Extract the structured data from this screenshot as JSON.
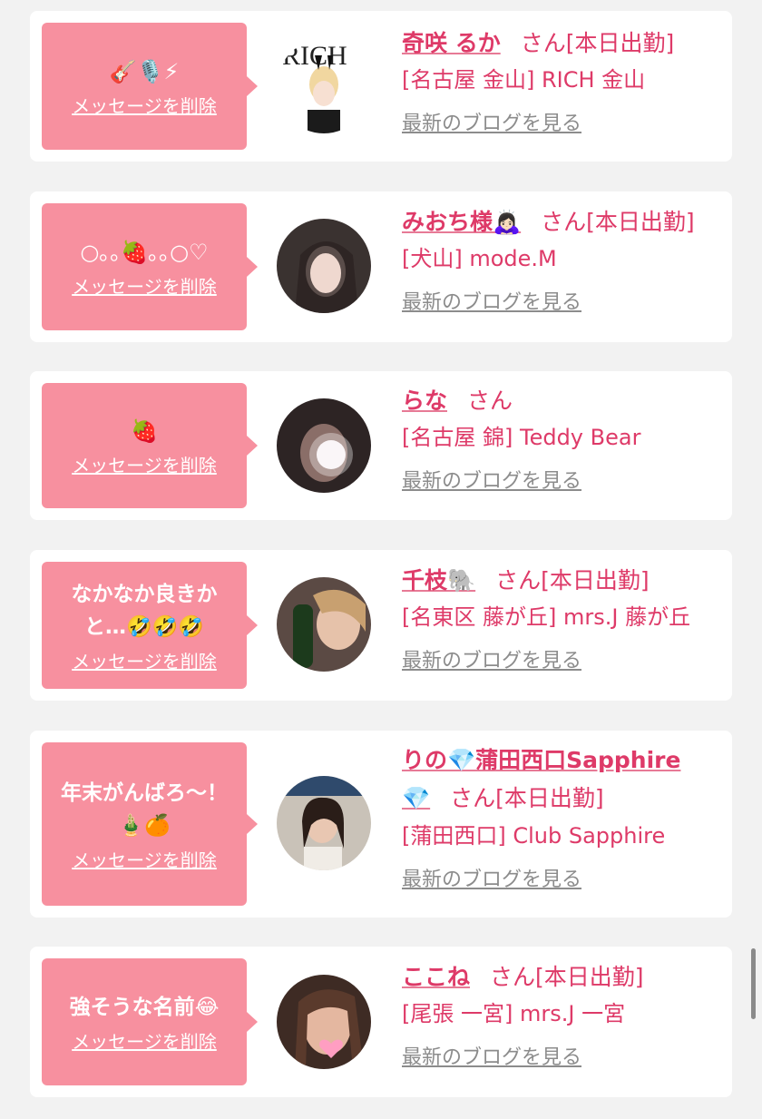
{
  "colors": {
    "bubble": "#f7909f",
    "name": "#de3a68",
    "link_gray": "#8c8c8c",
    "page_bg": "#f2f2f2"
  },
  "cards": [
    {
      "message": "🎸🎙️⚡",
      "delete_label": "メッセージを削除",
      "name": "奇咲 るか",
      "san_status": "さん[本日出勤]",
      "shop": "[名古屋 金山] RICH 金山",
      "blog_label": "最新のブログを見る",
      "avatar_icon": "avatar-photo"
    },
    {
      "message": "○｡｡🍓｡｡○♡",
      "delete_label": "メッセージを削除",
      "name": "みおち様🙇🏻‍♀️",
      "san_status": "さん[本日出勤]",
      "shop": "[犬山] mode.M",
      "blog_label": "最新のブログを見る",
      "avatar_icon": "avatar-photo"
    },
    {
      "message": "🍓",
      "delete_label": "メッセージを削除",
      "name": "らな",
      "san_status": "さん",
      "shop": "[名古屋 錦] Teddy Bear",
      "blog_label": "最新のブログを見る",
      "avatar_icon": "avatar-photo"
    },
    {
      "message": "なかなか良きかと…🤣🤣🤣",
      "delete_label": "メッセージを削除",
      "name": "千枝🐘",
      "san_status": "さん[本日出勤]",
      "shop": "[名東区 藤が丘] mrs.J 藤が丘",
      "blog_label": "最新のブログを見る",
      "avatar_icon": "avatar-photo"
    },
    {
      "message": "年末がんばろ〜！🎍🍊",
      "delete_label": "メッセージを削除",
      "name": "りの💎蒲田西口Sapphire💎",
      "san_status": "さん[本日出勤]",
      "shop": "[蒲田西口] Club Sapphire",
      "blog_label": "最新のブログを見る",
      "avatar_icon": "avatar-photo"
    },
    {
      "message": "強そうな名前😂",
      "delete_label": "メッセージを削除",
      "name": "ここね",
      "san_status": "さん[本日出勤]",
      "shop": "[尾張 一宮] mrs.J 一宮",
      "blog_label": "最新のブログを見る",
      "avatar_icon": "avatar-photo"
    }
  ]
}
